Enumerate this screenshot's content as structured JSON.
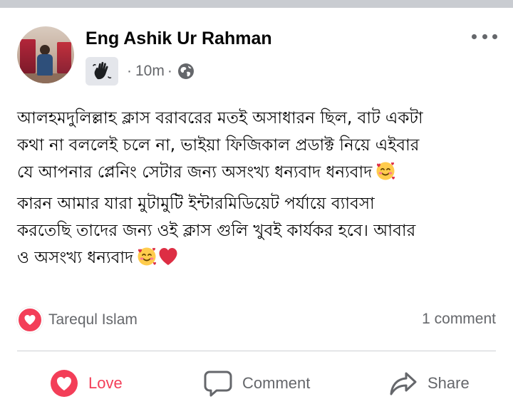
{
  "post": {
    "author": "Eng Ashik Ur Rahman",
    "time": "10m",
    "separator": "·",
    "body_lines": [
      "আলহমদুলিল্লাহ ক্লাস বরাবরের মতই অসাধারন ছিল, বাট একটা",
      "কথা না বললেই চলে না, ভাইয়া ফিজিকাল প্রডাক্ট নিয়ে এইবার",
      "যে আপনার প্লেনিং সেটার জন্য অসংখ্য ধন্যবাদ ধন্যবাদ",
      "কারন আমার যারা মুটামুটি ইন্টারমিডিয়েট পর্যায়ে ব্যাবসা",
      "করতেছি তাদের জন্য ওই ক্লাস গুলি খুবই কার্যকর হবে। আবার",
      "ও অসংখ্য ধন্যবাদ"
    ],
    "emojis": [
      "smiling-face-with-hearts",
      "red-heart"
    ]
  },
  "reactions": {
    "type": "love",
    "reactor": "Tarequl Islam",
    "comments": "1 comment"
  },
  "actions": {
    "love": "Love",
    "comment": "Comment",
    "share": "Share"
  },
  "colors": {
    "love": "#f33e58",
    "secondary_text": "#65676b",
    "divider": "#ced0d4"
  },
  "icons": {
    "wave": "waving-hand-icon",
    "audience": "globe-icon",
    "more": "more-options-icon"
  }
}
